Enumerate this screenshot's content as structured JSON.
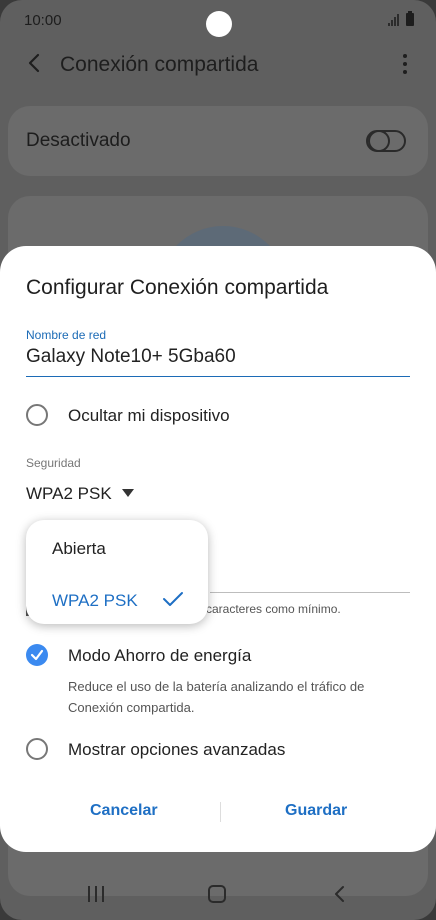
{
  "status_bar": {
    "time": "10:00"
  },
  "app_bar": {
    "title": "Conexión compartida",
    "back_icon": "back-arrow-icon",
    "menu_icon": "more-vert-icon"
  },
  "toggle": {
    "label": "Desactivado",
    "state": "off"
  },
  "dialog": {
    "title": "Configurar Conexión compartida",
    "network_name": {
      "label": "Nombre de red",
      "value": "Galaxy Note10+ 5Gba60"
    },
    "hide_device": {
      "label": "Ocultar mi dispositivo",
      "checked": false
    },
    "security": {
      "label": "Seguridad",
      "value": "WPA2 PSK"
    },
    "password_hint": "caracteres como mínimo.",
    "power_saving": {
      "label": "Modo Ahorro de energía",
      "description": "Reduce el uso de la batería analizando el tráfico de Conexión compartida.",
      "checked": true
    },
    "advanced": {
      "label": "Mostrar opciones avanzadas",
      "checked": false
    },
    "cancel_label": "Cancelar",
    "save_label": "Guardar"
  },
  "dropdown": {
    "options": [
      {
        "label": "Abierta",
        "selected": false
      },
      {
        "label": "WPA2 PSK",
        "selected": true
      }
    ]
  },
  "colors": {
    "accent": "#1e6fc4",
    "check": "#3b8af0"
  }
}
